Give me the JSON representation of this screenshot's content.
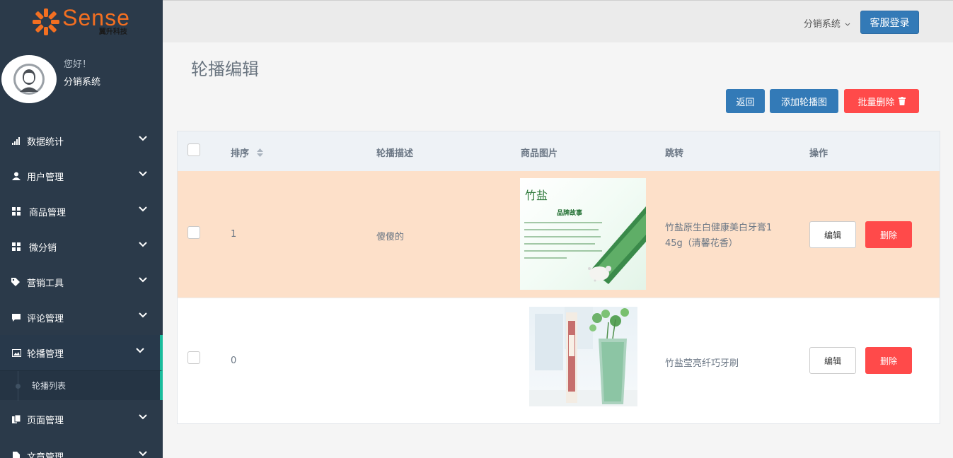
{
  "brand": {
    "name": "Sense",
    "subtitle": "翼升科技"
  },
  "user": {
    "greeting": "您好！",
    "name": "分销系统"
  },
  "sidebar": {
    "items": [
      {
        "label": "数据统计",
        "icon": "bar-chart-icon"
      },
      {
        "label": "用户管理",
        "icon": "user-icon"
      },
      {
        "label": "商品管理",
        "icon": "grid-icon"
      },
      {
        "label": "微分销",
        "icon": "grid-icon"
      },
      {
        "label": "营销工具",
        "icon": "tags-icon"
      },
      {
        "label": "评论管理",
        "icon": "comment-icon"
      },
      {
        "label": "轮播管理",
        "icon": "image-icon"
      },
      {
        "label": "页面管理",
        "icon": "files-icon"
      },
      {
        "label": "文章管理",
        "icon": "file-icon"
      }
    ],
    "subitem": "轮播列表"
  },
  "topbar": {
    "system": "分销系统",
    "login": "客服登录"
  },
  "page": {
    "title": "轮播编辑"
  },
  "actions": {
    "back": "返回",
    "add": "添加轮播图",
    "batch_delete": "批量删除"
  },
  "table": {
    "headers": {
      "sort": "排序",
      "desc": "轮播描述",
      "image": "商品图片",
      "jump": "跳转",
      "ops": "操作"
    },
    "rows": [
      {
        "order": "1",
        "desc": "傻傻的",
        "jump_line1": "竹盐原生白健康美白牙膏1",
        "jump_line2": "45g（清馨花香）",
        "edit": "编辑",
        "delete": "删除",
        "image_text": {
          "logo": "竹盐",
          "heading": "品牌故事"
        }
      },
      {
        "order": "0",
        "desc": "",
        "jump_line1": "竹盐莹亮纤巧牙刷",
        "jump_line2": "",
        "edit": "编辑",
        "delete": "删除"
      }
    ]
  },
  "colors": {
    "sidebar": "#2b3a4a",
    "primary": "#337ab7",
    "danger": "#ff4a4a",
    "highlight_row": "#fde0c9",
    "accent": "#1abc9c",
    "brand": "#f36f21"
  }
}
